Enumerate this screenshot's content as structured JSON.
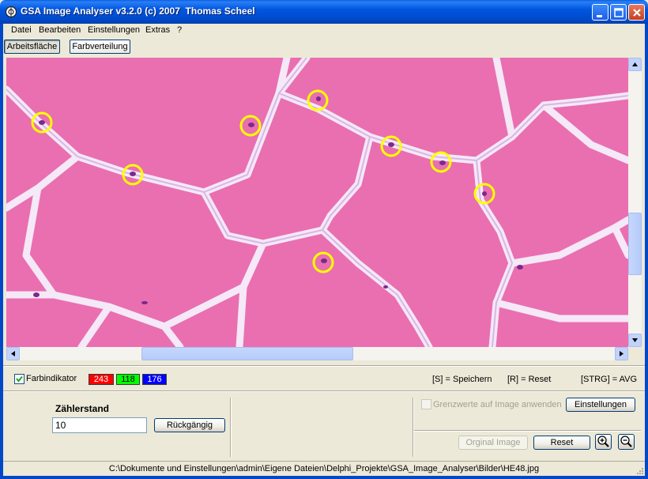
{
  "window": {
    "title": "GSA Image Analyser v3.2.0 (c) 2007  Thomas Scheel"
  },
  "menu": [
    {
      "label": "Datei"
    },
    {
      "label": "Bearbeiten"
    },
    {
      "label": "Einstellungen"
    },
    {
      "label": "Extras"
    },
    {
      "label": "?"
    }
  ],
  "tabs": [
    {
      "label": "Arbeitsfläche",
      "active": true
    },
    {
      "label": "Farbverteilung",
      "active": false
    }
  ],
  "image": {
    "description_icon": "histology-image",
    "background_color": "#e96fb1",
    "marker_color": "#ffff00",
    "marker_count": 10
  },
  "indicator": {
    "checkbox_label": "Farbindikator",
    "checked": true,
    "red_value": "243",
    "green_value": "118",
    "blue_value": "176",
    "red_color": "#ff0000",
    "green_color": "#00ff00",
    "blue_color": "#0000ff"
  },
  "shortcuts": {
    "save": "[S] = Speichern",
    "reset": "[R] = Reset",
    "avg": "[STRG] = AVG"
  },
  "counter": {
    "label": "Zählerstand",
    "value": "10",
    "undo_button": "Rückgängig"
  },
  "thresholds": {
    "checkbox_label": "Grenzwerte auf Image anwenden",
    "settings_button": "Einstellungen"
  },
  "view": {
    "original_button": "Orginal Image",
    "reset_button": "Reset"
  },
  "status": {
    "path": "C:\\Dokumente und Einstellungen\\admin\\Eigene Dateien\\Delphi_Projekte\\GSA_Image_Analyser\\Bilder\\HE48.jpg"
  }
}
